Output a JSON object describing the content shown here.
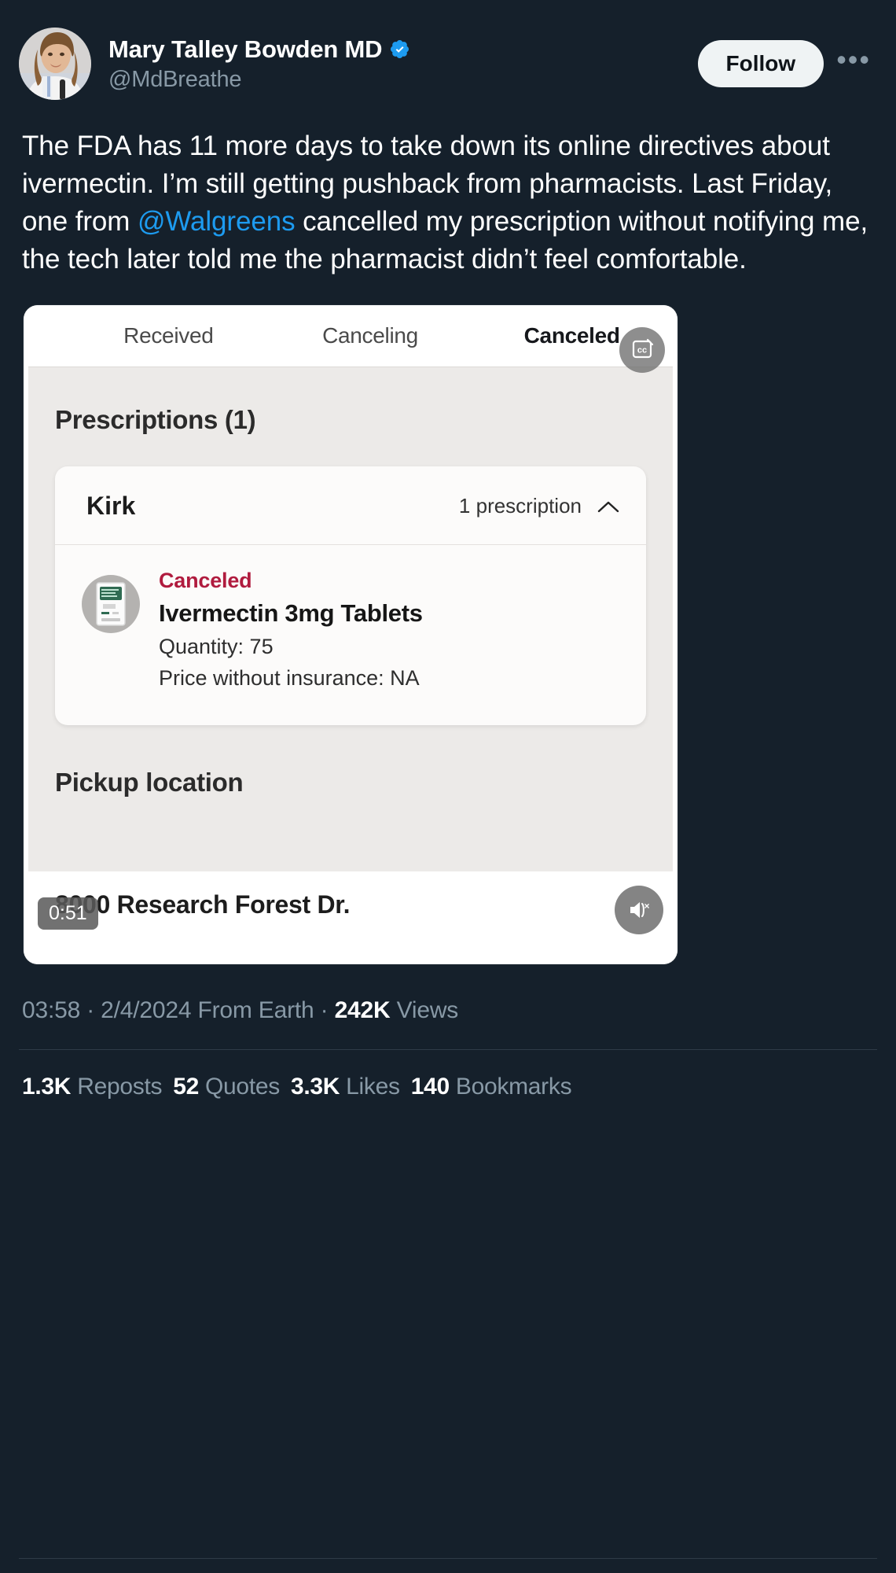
{
  "account": {
    "display_name": "Mary Talley Bowden MD",
    "handle": "@MdBreathe",
    "verified_badge": "verified-check-icon",
    "avatar_alt": "profile-photo"
  },
  "actions": {
    "follow_label": "Follow",
    "more_label": "•••"
  },
  "tweet": {
    "text_part1": "The FDA has 11 more days to take down its online directives about ivermectin.  I’m still getting pushback from pharmacists.  Last Friday, one from ",
    "mention": "@Walgreens",
    "text_part2": " cancelled my prescription without notifying me, the tech later told me the pharmacist didn’t feel comfortable."
  },
  "media": {
    "type": "video",
    "duration": "0:51",
    "cc_icon": "closed-caption-icon",
    "mute_icon": "muted-speaker-icon",
    "tabs": [
      {
        "label": "Received",
        "active": false
      },
      {
        "label": "Canceling",
        "active": false
      },
      {
        "label": "Canceled",
        "active": true
      }
    ],
    "section_title": "Prescriptions (1)",
    "prescription_card": {
      "patient": "Kirk",
      "count_label": "1 prescription",
      "collapse_icon": "chevron-up-icon",
      "thumb_icon": "prescription-bottle-icon",
      "status": "Canceled",
      "drug": "Ivermectin 3mg Tablets",
      "quantity_line": "Quantity: 75",
      "price_line": "Price without insurance: NA"
    },
    "pickup_title": "Pickup location",
    "pickup_address": "8000 Research Forest Dr."
  },
  "meta": {
    "time": "03:58",
    "separator1": " · ",
    "date": "2/4/2024",
    "source": " From Earth",
    "separator2": " · ",
    "views_count": "242K",
    "views_label": " Views"
  },
  "stats": [
    {
      "count": "1.3K",
      "label": "Reposts"
    },
    {
      "count": "52",
      "label": "Quotes"
    },
    {
      "count": "3.3K",
      "label": "Likes"
    },
    {
      "count": "140",
      "label": "Bookmarks"
    }
  ],
  "colors": {
    "background": "#15202b",
    "accent_blue": "#1d9bf0",
    "muted_text": "#8899a6",
    "canceled_red": "#b01b3e",
    "follow_bg": "#eff3f4"
  }
}
